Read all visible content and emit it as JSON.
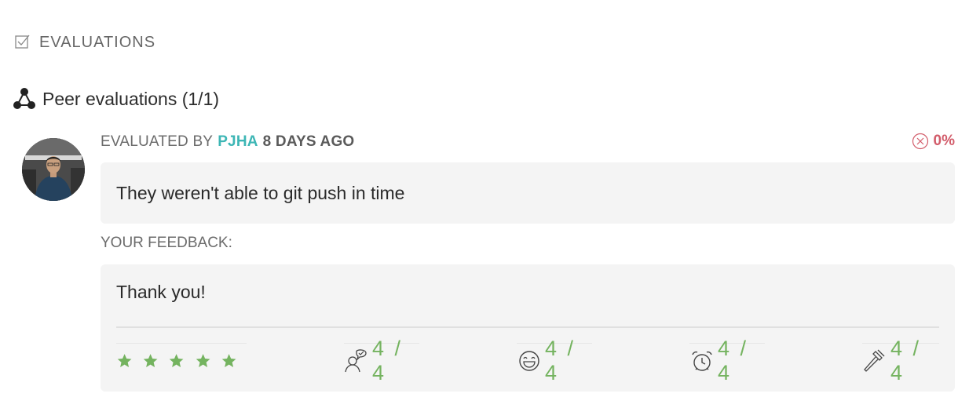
{
  "section": {
    "title": "EVALUATIONS",
    "icon": "checkbox-icon"
  },
  "peer": {
    "title": "Peer evaluations (1/1)",
    "icon": "peer-graph-icon"
  },
  "evaluation": {
    "prefix": "EVALUATED BY",
    "user": "PJHA",
    "time": "8 DAYS AGO",
    "score": "0%",
    "score_color": "#d25c6a",
    "comment": "They weren't able to git push in time",
    "feedback_label": "YOUR FEEDBACK:",
    "feedback_text": "Thank you!",
    "stars": {
      "value": 5,
      "max": 5
    },
    "ratings": [
      {
        "icon": "interested-icon",
        "value": "4 / 4"
      },
      {
        "icon": "smile-icon",
        "value": "4 / 4"
      },
      {
        "icon": "alarm-clock-icon",
        "value": "4 / 4"
      },
      {
        "icon": "hammer-icon",
        "value": "4 / 4"
      }
    ]
  },
  "colors": {
    "accent": "#3db6b5",
    "rating": "#74b35f",
    "fail": "#d25c6a"
  }
}
